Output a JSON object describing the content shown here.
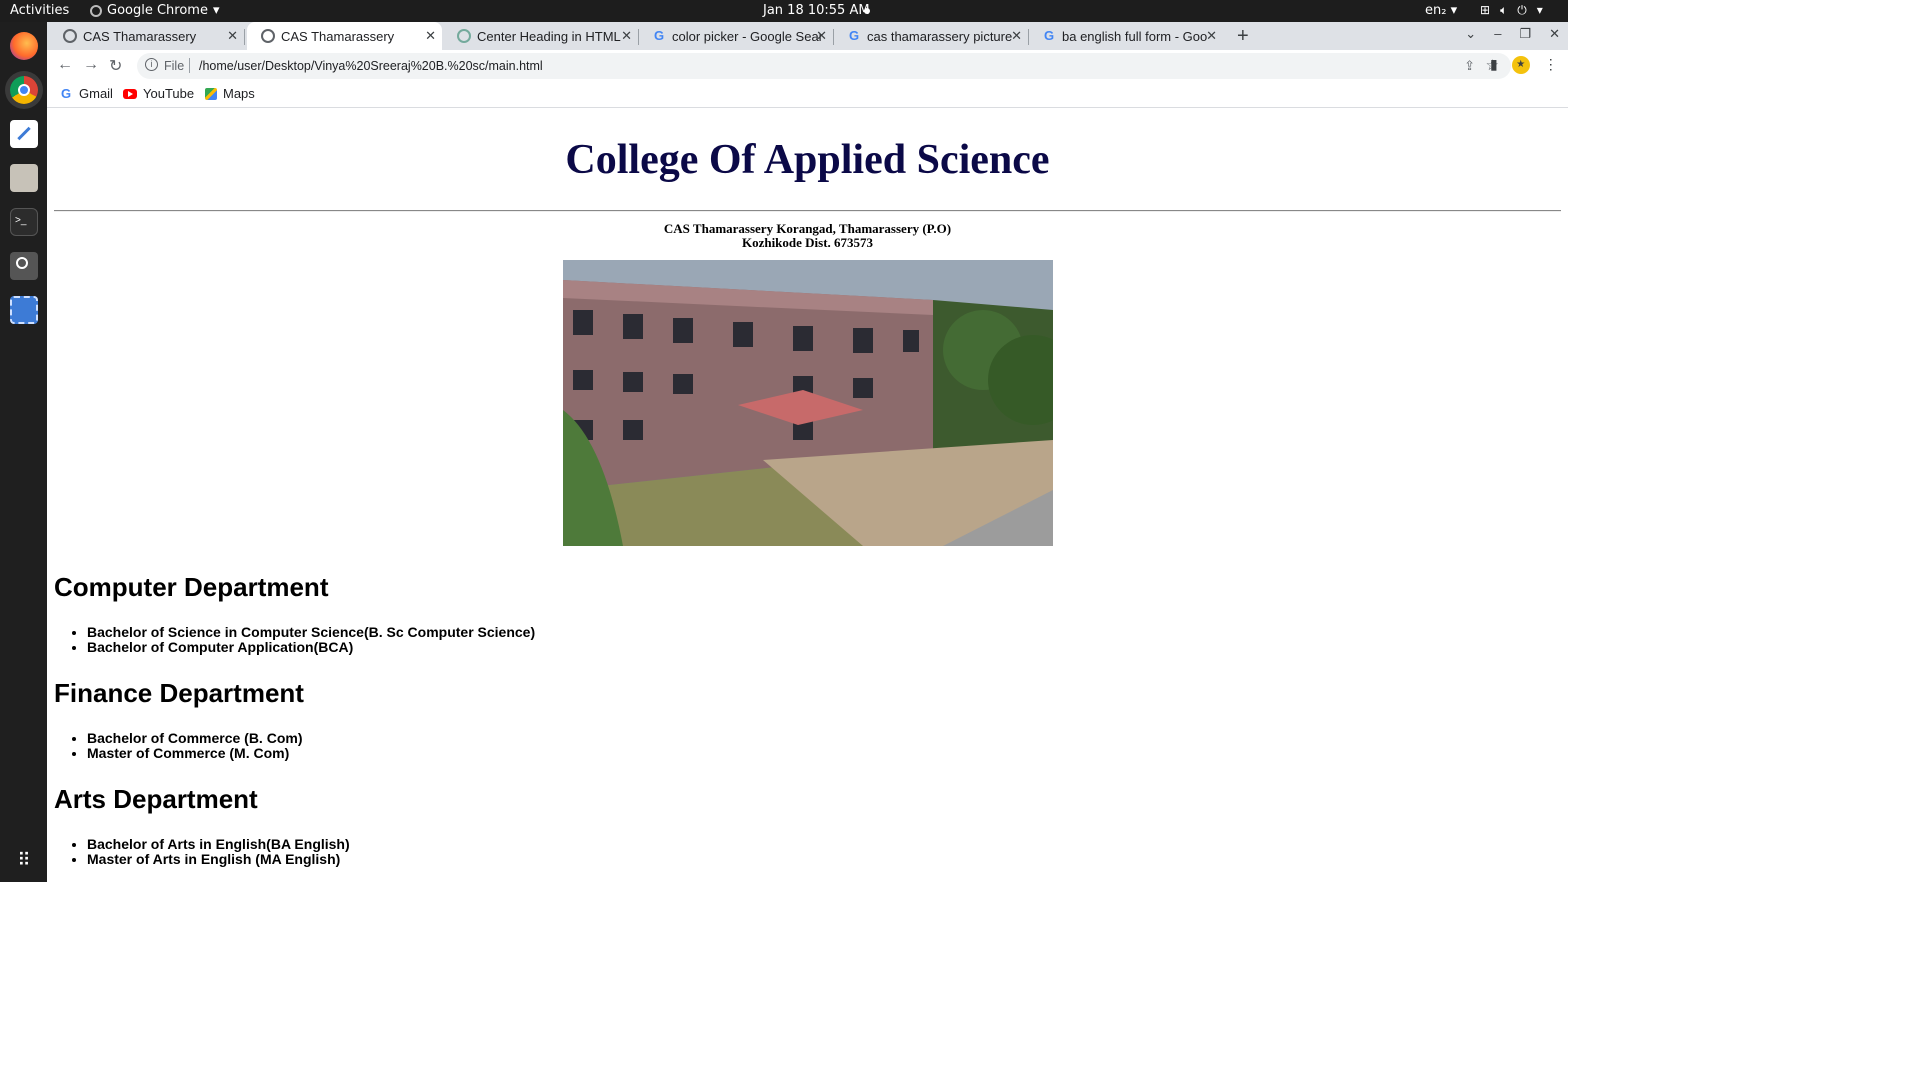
{
  "topbar": {
    "activities": "Activities",
    "app": "Google Chrome",
    "clock": "Jan 18  10:55 AM",
    "lang": "en₂"
  },
  "tabs": [
    {
      "title": "CAS Thamarassery",
      "active": false
    },
    {
      "title": "CAS Thamarassery",
      "active": true
    },
    {
      "title": "Center Heading in HTML",
      "active": false
    },
    {
      "title": "color picker - Google Sear",
      "active": false
    },
    {
      "title": "cas thamarassery picture",
      "active": false
    },
    {
      "title": "ba english full form - Goo",
      "active": false
    }
  ],
  "omnibox": {
    "scheme": "File",
    "url": "/home/user/Desktop/Vinya%20Sreeraj%20B.%20sc/main.html"
  },
  "bookmarks": [
    {
      "label": "Gmail"
    },
    {
      "label": "YouTube"
    },
    {
      "label": "Maps"
    }
  ],
  "page": {
    "title": "College Of Applied Science",
    "address_line1": "CAS Thamarassery Korangad, Thamarassery (P.O)",
    "address_line2": "Kozhikode Dist. 673573",
    "departments": [
      {
        "name": "Computer Department",
        "courses": [
          "Bachelor of Science in Computer Science(B. Sc Computer Science)",
          "Bachelor of Computer Application(BCA)"
        ]
      },
      {
        "name": "Finance Department",
        "courses": [
          "Bachelor of Commerce (B. Com)",
          "Master of Commerce (M. Com)"
        ]
      },
      {
        "name": "Arts Department",
        "courses": [
          "Bachelor of Arts in English(BA English)",
          "Master of Arts in English (MA English)"
        ]
      }
    ]
  },
  "colors": {
    "heading": "#0b0947",
    "topbar": "#1d1d1d",
    "dock": "#1f1f1f",
    "chrome_frame": "#dee1e6"
  }
}
